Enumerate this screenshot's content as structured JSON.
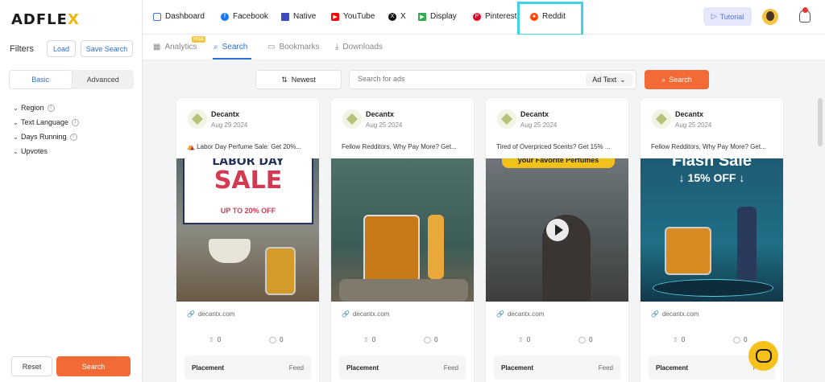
{
  "brand": {
    "logo_text": "ADFLE",
    "logo_x": "X"
  },
  "sidebar": {
    "filters_title": "Filters",
    "load_label": "Load",
    "save_search_label": "Save Search",
    "tabs": [
      "Basic",
      "Advanced"
    ],
    "filters": [
      "Region",
      "Text Language",
      "Days Running",
      "Upvotes"
    ],
    "reset_label": "Reset",
    "search_label": "Search"
  },
  "nav": {
    "items": [
      {
        "label": "Dashboard",
        "icon": "grid-icon"
      },
      {
        "label": "Facebook",
        "icon": "facebook-icon"
      },
      {
        "label": "Native",
        "icon": "native-icon"
      },
      {
        "label": "YouTube",
        "icon": "youtube-icon"
      },
      {
        "label": "X",
        "icon": "x-icon"
      },
      {
        "label": "Display",
        "icon": "display-icon"
      },
      {
        "label": "Pinterest",
        "icon": "pinterest-icon"
      },
      {
        "label": "Reddit",
        "icon": "reddit-icon"
      }
    ],
    "tutorial_label": "Tutorial"
  },
  "subtabs": {
    "items": [
      "Analytics",
      "Search",
      "Bookmarks",
      "Downloads"
    ],
    "free_badge": "FREE"
  },
  "searchbar": {
    "sort_label": "Newest",
    "placeholder": "Search for ads",
    "scope_label": "Ad Text",
    "search_label": "Search"
  },
  "cards": [
    {
      "name": "Decantx",
      "date": "Aug 29 2024",
      "text": "⛺ Labor Day Perfume Sale: Get 20%...",
      "domain": "decantx.com",
      "upvotes": "0",
      "comments": "0",
      "placement_label": "Placement",
      "placement_value": "Feed",
      "creative": {
        "line1": "LABOR DAY",
        "line2": "SALE",
        "line3": "UP TO 20% OFF"
      }
    },
    {
      "name": "Decantx",
      "date": "Aug 25 2024",
      "text": "Fellow Redditors, Why Pay More? Get...",
      "domain": "decantx.com",
      "upvotes": "0",
      "comments": "0",
      "placement_label": "Placement",
      "placement_value": "Feed"
    },
    {
      "name": "Decantx",
      "date": "Aug 25 2024",
      "text": "Tired of Overpriced Scents? Get 15% ...",
      "domain": "decantx.com",
      "upvotes": "0",
      "comments": "0",
      "placement_label": "Placement",
      "placement_value": "Feed",
      "creative": {
        "line1": "your Favorite Perfumes"
      }
    },
    {
      "name": "Decantx",
      "date": "Aug 25 2024",
      "text": "Fellow Redditors, Why Pay More? Get...",
      "domain": "decantx.com",
      "upvotes": "0",
      "comments": "0",
      "placement_label": "Placement",
      "placement_value": "Feed",
      "creative": {
        "line1": "Flash Sale",
        "line2": "↓ 15% OFF ↓"
      }
    }
  ],
  "colors": {
    "accent": "#f26a35",
    "link": "#2f6fd1",
    "highlight": "#3fd3e6"
  }
}
